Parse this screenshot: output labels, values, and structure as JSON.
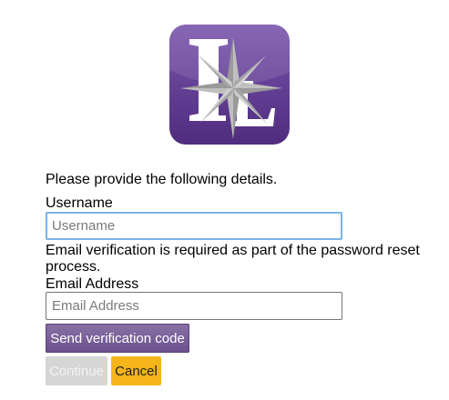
{
  "logo": {
    "letters": "LL",
    "bg_color": "#5f3b8e"
  },
  "form": {
    "intro": "Please provide the following details.",
    "username_label": "Username",
    "username_placeholder": "Username",
    "verification_note": "Email verification is required as part of the password reset process.",
    "email_label": "Email Address",
    "email_placeholder": "Email Address"
  },
  "buttons": {
    "send_code": "Send verification code",
    "continue": "Continue",
    "cancel": "Cancel"
  },
  "colors": {
    "accent_purple": "#6a4f8c",
    "cancel_yellow": "#f5b51b",
    "focus_blue": "#7bb4e6",
    "disabled_gray": "#d6d6d6"
  }
}
